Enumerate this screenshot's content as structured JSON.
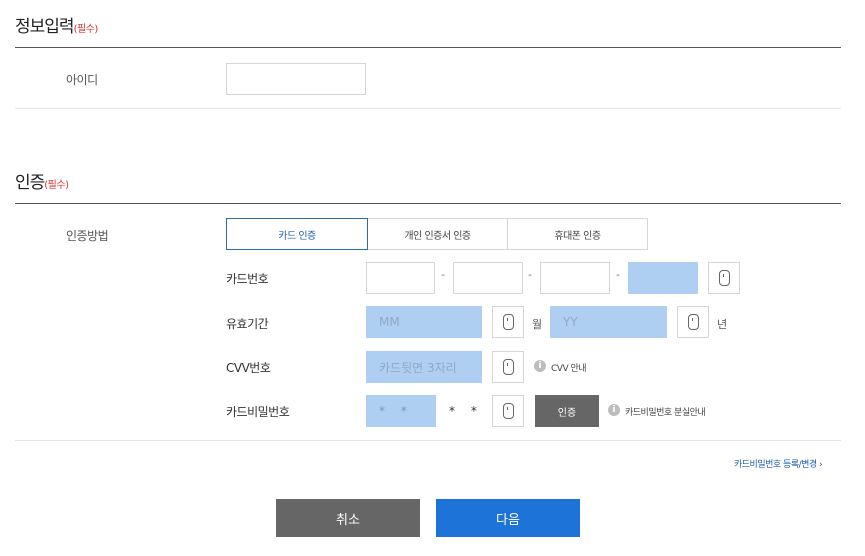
{
  "info": {
    "title": "정보입력",
    "required": "(필수)",
    "id_label": "아이디",
    "id_value": ""
  },
  "auth": {
    "title": "인증",
    "required": "(필수)",
    "method_label": "인증방법",
    "tabs": [
      "카드 인증",
      "개인 인증서 인증",
      "휴대폰 인증"
    ],
    "card_number_label": "카드번호",
    "dash": "-",
    "expiry_label": "유효기간",
    "month_placeholder": "MM",
    "month_unit": "월",
    "year_placeholder": "YY",
    "year_unit": "년",
    "cvv_label": "CVV번호",
    "cvv_placeholder": "카드뒷면 3자리",
    "cvv_info": "CVV 안내",
    "pw_label": "카드비밀번호",
    "pw_entered": "* *",
    "pw_masked": "* *",
    "verify_button": "인증",
    "pw_info": "카드비밀번호 분실안내",
    "info_icon_glyph": "i",
    "register_link": "카드비밀번호 등록/변경 ›"
  },
  "buttons": {
    "cancel": "취소",
    "next": "다음"
  },
  "colors": {
    "primary": "#1e73d8",
    "dark_button": "#666666",
    "secure_field": "#aecff2",
    "required_red": "#dd3333"
  },
  "icons": [
    "keyboard-icon",
    "info-icon",
    "chevron-right-icon"
  ]
}
